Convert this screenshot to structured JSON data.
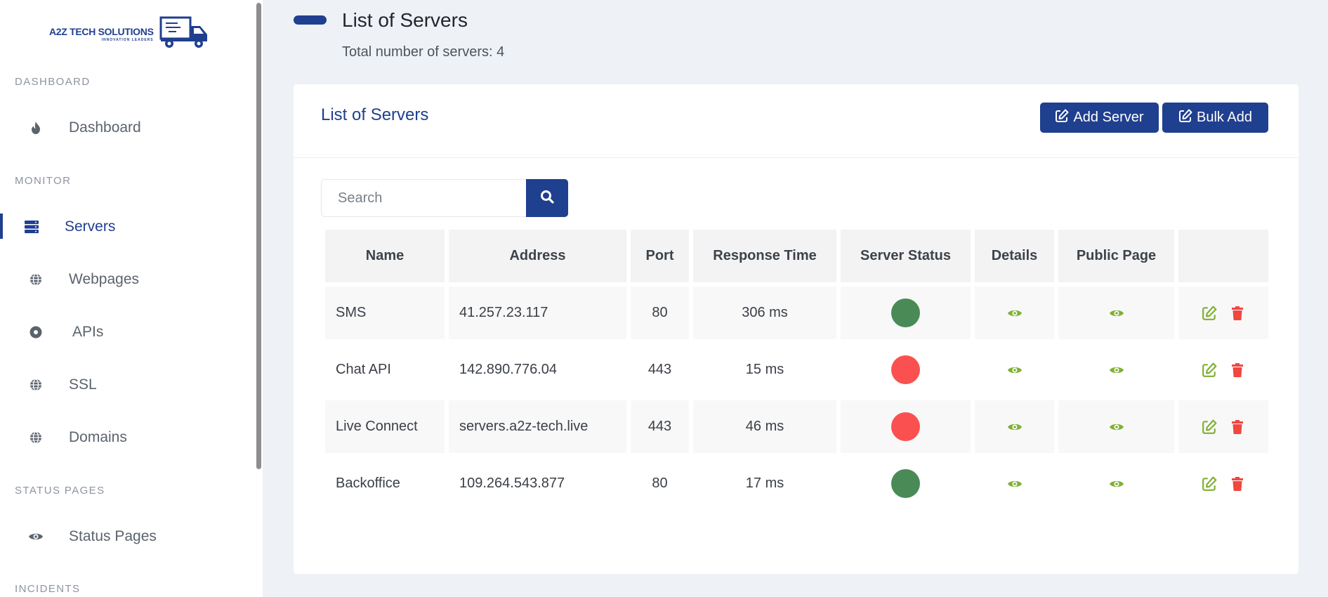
{
  "app": {
    "logo_title": "A2Z TECH SOLUTIONS",
    "logo_subtitle": "INNOVATION LEADERS"
  },
  "sidebar": {
    "sections": [
      {
        "label": "DASHBOARD"
      },
      {
        "label": "MONITOR"
      },
      {
        "label": "STATUS PAGES"
      },
      {
        "label": "INCIDENTS"
      }
    ],
    "items": [
      {
        "label": "Dashboard",
        "icon": "fire-icon",
        "active": false
      },
      {
        "label": "Servers",
        "icon": "server-icon",
        "active": true
      },
      {
        "label": "Webpages",
        "icon": "globe-icon",
        "active": false
      },
      {
        "label": "APIs",
        "icon": "dot-circle-icon",
        "active": false
      },
      {
        "label": "SSL",
        "icon": "globe-icon",
        "active": false
      },
      {
        "label": "Domains",
        "icon": "globe-icon",
        "active": false
      },
      {
        "label": "Status Pages",
        "icon": "eye-icon",
        "active": false
      }
    ]
  },
  "page": {
    "title": "List of Servers",
    "subtitle": "Total number of servers: 4"
  },
  "card": {
    "title": "List of Servers",
    "add_server_label": "Add Server",
    "bulk_add_label": "Bulk Add",
    "search_placeholder": "Search"
  },
  "table": {
    "columns": [
      "Name",
      "Address",
      "Port",
      "Response Time",
      "Server Status",
      "Details",
      "Public Page",
      ""
    ],
    "rows": [
      {
        "name": "SMS",
        "address": "41.257.23.117",
        "port": "80",
        "response_time": "306 ms",
        "status": "up"
      },
      {
        "name": "Chat API",
        "address": "142.890.776.04",
        "port": "443",
        "response_time": "15 ms",
        "status": "down"
      },
      {
        "name": "Live Connect",
        "address": "servers.a2z-tech.live",
        "port": "443",
        "response_time": "46 ms",
        "status": "down"
      },
      {
        "name": "Backoffice",
        "address": "109.264.543.877",
        "port": "80",
        "response_time": "17 ms",
        "status": "up"
      }
    ]
  },
  "colors": {
    "brand": "#1f3f8f",
    "status_up": "#4a8a57",
    "status_down": "#fa5150",
    "view_icon": "#7fb034",
    "edit_icon": "#7fb034",
    "delete_icon": "#f04740"
  }
}
